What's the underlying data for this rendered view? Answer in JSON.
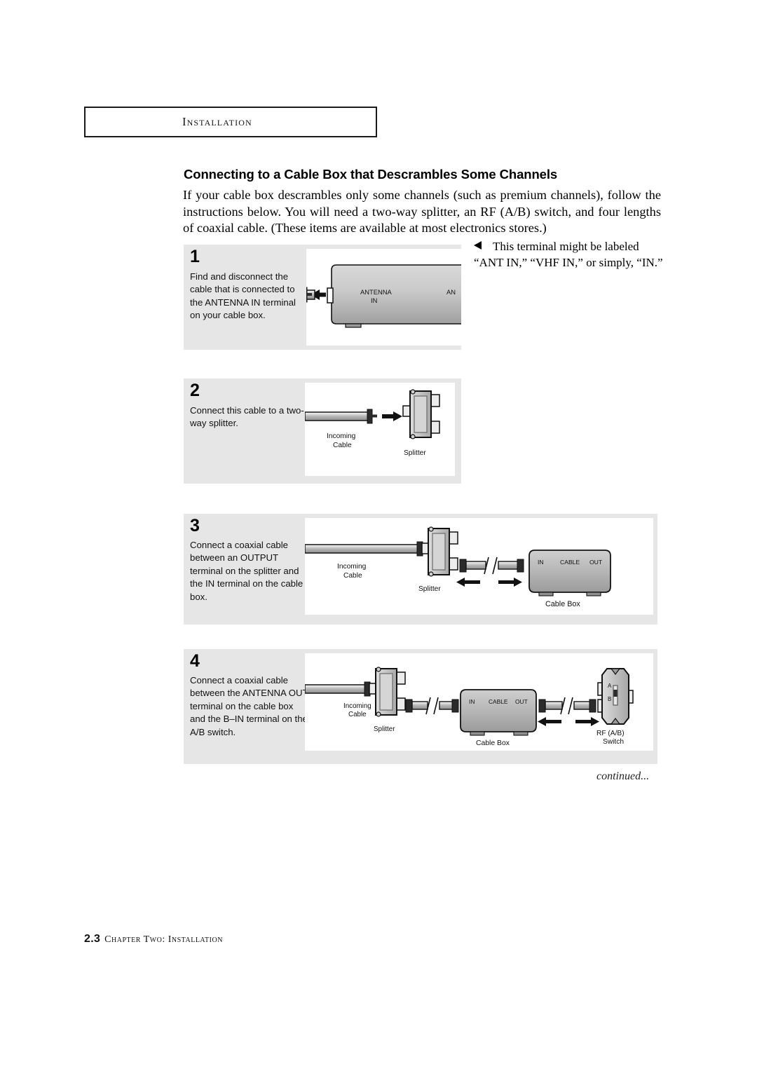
{
  "header": {
    "label": "Installation"
  },
  "section": {
    "title": "Connecting to a Cable Box that Descrambles Some Channels",
    "intro": "If your cable box descrambles only some channels (such as premium channels), follow the instructions below. You will need a two-way splitter, an RF (A/B) switch, and four lengths of coaxial cable. (These items are available at most electronics stores.)"
  },
  "sidenote": {
    "marker": "left-triangle",
    "text": "This terminal might be labeled “ANT IN,” “VHF IN,” or simply, “IN.”"
  },
  "steps": [
    {
      "number": "1",
      "text": "Find and disconnect the cable that is connected to the ANTENNA IN terminal on your cable box.",
      "diagram_labels": {
        "antenna_in": "ANTENNA\nIN",
        "antenna_in_line1": "ANTENNA",
        "antenna_in_line2": "IN",
        "cropped": "AN"
      }
    },
    {
      "number": "2",
      "text": "Connect this cable to a two-way splitter.",
      "diagram_labels": {
        "incoming_line1": "Incoming",
        "incoming_line2": "Cable",
        "splitter": "Splitter"
      }
    },
    {
      "number": "3",
      "text": "Connect a coaxial cable between an OUTPUT terminal on the splitter and the IN terminal on the cable box.",
      "diagram_labels": {
        "incoming_line1": "Incoming",
        "incoming_line2": "Cable",
        "splitter": "Splitter",
        "cable_box": "Cable Box",
        "port_in": "IN",
        "port_cable": "CABLE",
        "port_out": "OUT"
      }
    },
    {
      "number": "4",
      "text": "Connect a coaxial cable between the ANTENNA OUT terminal on the cable box and the B–IN terminal on the A/B switch.",
      "diagram_labels": {
        "incoming_line1": "Incoming",
        "incoming_line2": "Cable",
        "splitter": "Splitter",
        "cable_box": "Cable Box",
        "port_in": "IN",
        "port_cable": "CABLE",
        "port_out": "OUT",
        "rf_switch_line1": "RF (A/B)",
        "rf_switch_line2": "Switch",
        "switch_a": "A",
        "switch_b": "B"
      }
    }
  ],
  "continued": "continued...",
  "footer": {
    "page": "2.3",
    "text": "Chapter Two: Installation"
  },
  "colors": {
    "panel_bg": "#e6e6e6",
    "diagram_bg": "#ffffff",
    "ink": "#000000",
    "device_gray": "#b8b8b8"
  }
}
